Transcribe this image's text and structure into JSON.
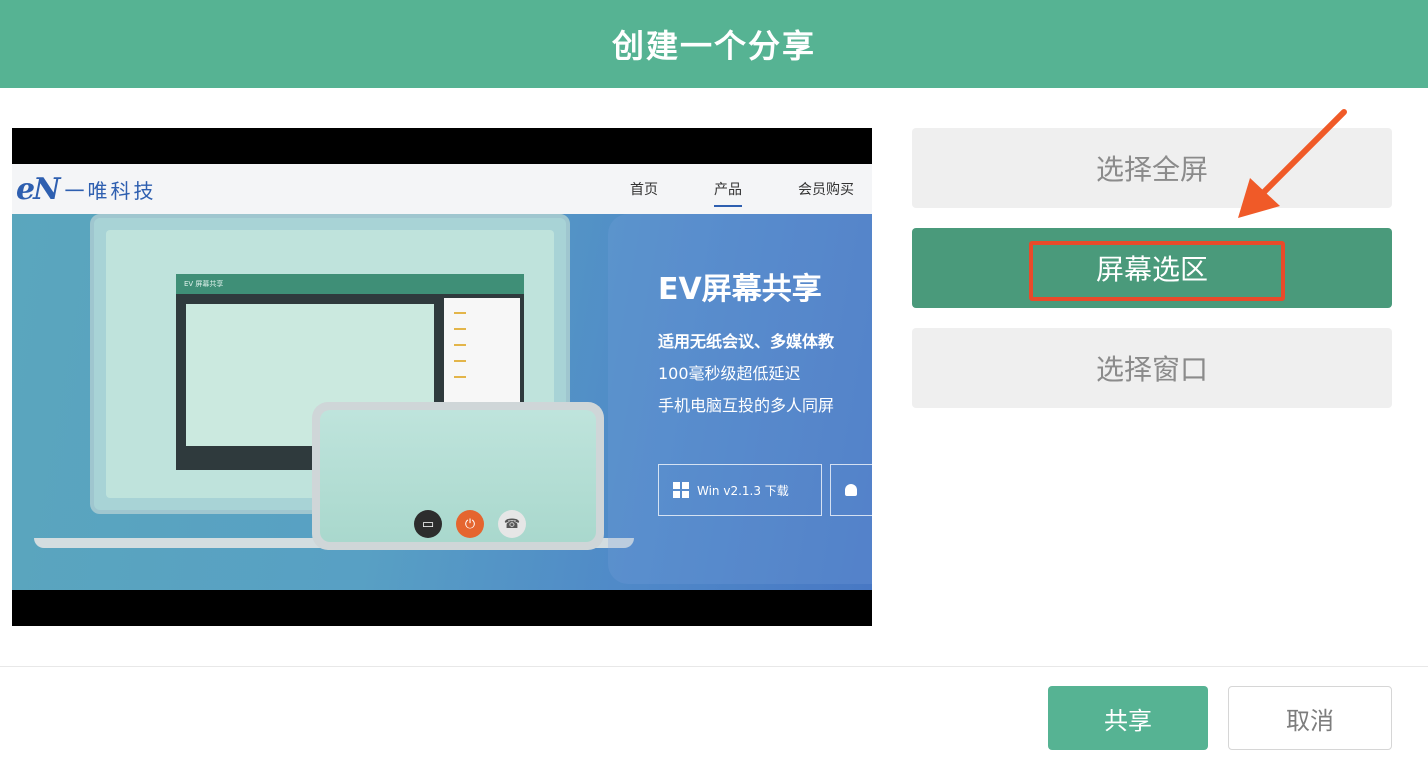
{
  "dialog": {
    "title": "创建一个分享"
  },
  "preview": {
    "site_logo_mark": "eN",
    "site_logo_text": "一唯科技",
    "nav": [
      "首页",
      "产品",
      "会员购买"
    ],
    "app_window_title": "EV 屏幕共享",
    "promo_title": "EV屏幕共享",
    "promo_lines": [
      "适用无纸会议、多媒体教",
      "100毫秒级超低延迟",
      "手机电脑互投的多人同屏"
    ],
    "download_buttons": [
      "Win v2.1.3 下载",
      ""
    ],
    "phone_buttons": [
      "▭",
      "⏻",
      "☎"
    ]
  },
  "options": [
    {
      "label": "选择全屏",
      "selected": false
    },
    {
      "label": "屏幕选区",
      "selected": true
    },
    {
      "label": "选择窗口",
      "selected": false
    }
  ],
  "footer": {
    "share_label": "共享",
    "cancel_label": "取消"
  },
  "colors": {
    "header": "#56b393",
    "selected_option": "#4a9a7b",
    "highlight": "#e94a2a"
  }
}
